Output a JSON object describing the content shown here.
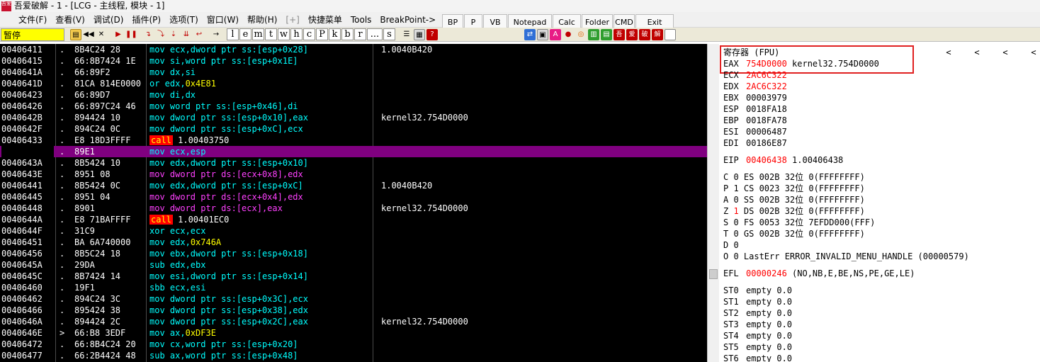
{
  "window": {
    "title": "吾爱破解 - 1 - [LCG - 主线程, 模块 - 1]",
    "app_icon_text": "吾爱"
  },
  "menu": {
    "items": [
      "文件(F)",
      "查看(V)",
      "调试(D)",
      "插件(P)",
      "选项(T)",
      "窗口(W)",
      "帮助(H)",
      "[+]",
      "快捷菜单",
      "Tools",
      "BreakPoint->"
    ]
  },
  "tool_buttons": [
    "BP",
    "P",
    "VB",
    "Notepad",
    "Calc",
    "Folder",
    "CMD",
    "Exit"
  ],
  "toolbar": {
    "status": "暂停",
    "letters": [
      "l",
      "e",
      "m",
      "t",
      "w",
      "h",
      "c",
      "P",
      "k",
      "b",
      "r",
      "...",
      "s"
    ]
  },
  "disasm": {
    "rows": [
      {
        "addr": "00406411",
        "mark": ".",
        "hex": "8B4C24 28",
        "op": "mov",
        "args": "ecx,dword ptr ss:[esp+0x28]",
        "cmt": "1.0040B420"
      },
      {
        "addr": "00406415",
        "mark": ".",
        "hex": "66:8B7424 1E",
        "op": "mov",
        "args": "si,word ptr ss:[esp+0x1E]",
        "cmt": ""
      },
      {
        "addr": "0040641A",
        "mark": ".",
        "hex": "66:89F2",
        "op": "mov",
        "args": "dx,si",
        "cmt": ""
      },
      {
        "addr": "0040641D",
        "mark": ".",
        "hex": "81CA 814E0000",
        "op": "or",
        "args": "edx,",
        "imm": "0x4E81",
        "cmt": ""
      },
      {
        "addr": "00406423",
        "mark": ".",
        "hex": "66:89D7",
        "op": "mov",
        "args": "di,dx",
        "cmt": ""
      },
      {
        "addr": "00406426",
        "mark": ".",
        "hex": "66:897C24 46",
        "op": "mov",
        "args": "word ptr ss:[esp+0x46],di",
        "cmt": ""
      },
      {
        "addr": "0040642B",
        "mark": ".",
        "hex": "894424 10",
        "op": "mov",
        "args": "dword ptr ss:[esp+0x10],eax",
        "cmt": "kernel32.754D0000"
      },
      {
        "addr": "0040642F",
        "mark": ".",
        "hex": "894C24 0C",
        "op": "mov",
        "args": "dword ptr ss:[esp+0xC],ecx",
        "cmt": ""
      },
      {
        "addr": "00406433",
        "mark": ".",
        "hex": "E8 18D3FFFF",
        "op": "call",
        "args": "1.00403750",
        "cmt": ""
      },
      {
        "addr": "00406438",
        "mark": ".",
        "hex": "89E1",
        "op": "mov",
        "args": "ecx,esp",
        "cmt": "",
        "selected": true
      },
      {
        "addr": "0040643A",
        "mark": ".",
        "hex": "8B5424 10",
        "op": "mov",
        "args": "edx,dword ptr ss:[esp+0x10]",
        "cmt": ""
      },
      {
        "addr": "0040643E",
        "mark": ".",
        "hex": "8951 08",
        "op": "mov",
        "args": "dword ptr ds:[ecx+0x8],edx",
        "cmt": "",
        "store": true
      },
      {
        "addr": "00406441",
        "mark": ".",
        "hex": "8B5424 0C",
        "op": "mov",
        "args": "edx,dword ptr ss:[esp+0xC]",
        "cmt": "1.0040B420"
      },
      {
        "addr": "00406445",
        "mark": ".",
        "hex": "8951 04",
        "op": "mov",
        "args": "dword ptr ds:[ecx+0x4],edx",
        "cmt": "",
        "store": true
      },
      {
        "addr": "00406448",
        "mark": ".",
        "hex": "8901",
        "op": "mov",
        "args": "dword ptr ds:[ecx],eax",
        "cmt": "kernel32.754D0000",
        "store": true
      },
      {
        "addr": "0040644A",
        "mark": ".",
        "hex": "E8 71BAFFFF",
        "op": "call",
        "args": "1.00401EC0",
        "cmt": ""
      },
      {
        "addr": "0040644F",
        "mark": ".",
        "hex": "31C9",
        "op": "xor",
        "args": "ecx,ecx",
        "cmt": ""
      },
      {
        "addr": "00406451",
        "mark": ".",
        "hex": "BA 6A740000",
        "op": "mov",
        "args": "edx,",
        "imm": "0x746A",
        "cmt": ""
      },
      {
        "addr": "00406456",
        "mark": ".",
        "hex": "8B5C24 18",
        "op": "mov",
        "args": "ebx,dword ptr ss:[esp+0x18]",
        "cmt": ""
      },
      {
        "addr": "0040645A",
        "mark": ".",
        "hex": "29DA",
        "op": "sub",
        "args": "edx,ebx",
        "cmt": ""
      },
      {
        "addr": "0040645C",
        "mark": ".",
        "hex": "8B7424 14",
        "op": "mov",
        "args": "esi,dword ptr ss:[esp+0x14]",
        "cmt": ""
      },
      {
        "addr": "00406460",
        "mark": ".",
        "hex": "19F1",
        "op": "sbb",
        "args": "ecx,esi",
        "cmt": ""
      },
      {
        "addr": "00406462",
        "mark": ".",
        "hex": "894C24 3C",
        "op": "mov",
        "args": "dword ptr ss:[esp+0x3C],ecx",
        "cmt": ""
      },
      {
        "addr": "00406466",
        "mark": ".",
        "hex": "895424 38",
        "op": "mov",
        "args": "dword ptr ss:[esp+0x38],edx",
        "cmt": ""
      },
      {
        "addr": "0040646A",
        "mark": ".",
        "hex": "894424 2C",
        "op": "mov",
        "args": "dword ptr ss:[esp+0x2C],eax",
        "cmt": "kernel32.754D0000"
      },
      {
        "addr": "0040646E",
        "mark": ">",
        "hex": "66:B8 3EDF",
        "op": "mov",
        "args": "ax,",
        "imm": "0xDF3E",
        "cmt": ""
      },
      {
        "addr": "00406472",
        "mark": ".",
        "hex": "66:8B4C24 20",
        "op": "mov",
        "args": "cx,word ptr ss:[esp+0x20]",
        "cmt": ""
      },
      {
        "addr": "00406477",
        "mark": ".",
        "hex": "66:2B4424 48",
        "op": "sub",
        "args": "ax,word ptr ss:[esp+0x48]",
        "cmt": ""
      }
    ]
  },
  "registers": {
    "title": "寄存器 (FPU)",
    "arrows": [
      "<",
      "<",
      "<",
      "<"
    ],
    "gp": [
      {
        "name": "EAX",
        "value": "754D0000",
        "info": "kernel32.754D0000",
        "changed": true
      },
      {
        "name": "ECX",
        "value": "2AC6C322",
        "info": "",
        "changed": true
      },
      {
        "name": "EDX",
        "value": "2AC6C322",
        "info": "",
        "changed": true
      },
      {
        "name": "EBX",
        "value": "00003979",
        "info": "",
        "changed": false
      },
      {
        "name": "ESP",
        "value": "0018FA18",
        "info": "",
        "changed": false
      },
      {
        "name": "EBP",
        "value": "0018FA78",
        "info": "",
        "changed": false
      },
      {
        "name": "ESI",
        "value": "00006487",
        "info": "",
        "changed": false
      },
      {
        "name": "EDI",
        "value": "00186E87",
        "info": "",
        "changed": false
      }
    ],
    "eip": {
      "name": "EIP",
      "value": "00406438",
      "info": "1.00406438"
    },
    "flags": [
      {
        "flag": "C",
        "val": "0",
        "seg": "ES",
        "sel": "002B",
        "bits": "32位",
        "base": "0(FFFFFFFF)",
        "changed": false
      },
      {
        "flag": "P",
        "val": "1",
        "seg": "CS",
        "sel": "0023",
        "bits": "32位",
        "base": "0(FFFFFFFF)",
        "changed": false
      },
      {
        "flag": "A",
        "val": "0",
        "seg": "SS",
        "sel": "002B",
        "bits": "32位",
        "base": "0(FFFFFFFF)",
        "changed": false
      },
      {
        "flag": "Z",
        "val": "1",
        "seg": "DS",
        "sel": "002B",
        "bits": "32位",
        "base": "0(FFFFFFFF)",
        "changed": true
      },
      {
        "flag": "S",
        "val": "0",
        "seg": "FS",
        "sel": "0053",
        "bits": "32位",
        "base": "7EFDD000(FFF)",
        "changed": false
      },
      {
        "flag": "T",
        "val": "0",
        "seg": "GS",
        "sel": "002B",
        "bits": "32位",
        "base": "0(FFFFFFFF)",
        "changed": false
      }
    ],
    "flag_d": {
      "flag": "D",
      "val": "0"
    },
    "flag_o": {
      "flag": "O",
      "val": "0",
      "label": "LastErr",
      "text": "ERROR_INVALID_MENU_HANDLE (00000579)"
    },
    "efl": {
      "name": "EFL",
      "value": "00000246",
      "info": "(NO,NB,E,BE,NS,PE,GE,LE)"
    },
    "fpu": [
      {
        "name": "ST0",
        "value": "empty 0.0"
      },
      {
        "name": "ST1",
        "value": "empty 0.0"
      },
      {
        "name": "ST2",
        "value": "empty 0.0"
      },
      {
        "name": "ST3",
        "value": "empty 0.0"
      },
      {
        "name": "ST4",
        "value": "empty 0.0"
      },
      {
        "name": "ST5",
        "value": "empty 0.0"
      },
      {
        "name": "ST6",
        "value": "empty 0.0"
      }
    ]
  },
  "colors": {
    "selected_row": "#800080",
    "changed_reg": "#ff0000",
    "status_bg": "#ffff00",
    "highlight_box": "#e02020"
  }
}
